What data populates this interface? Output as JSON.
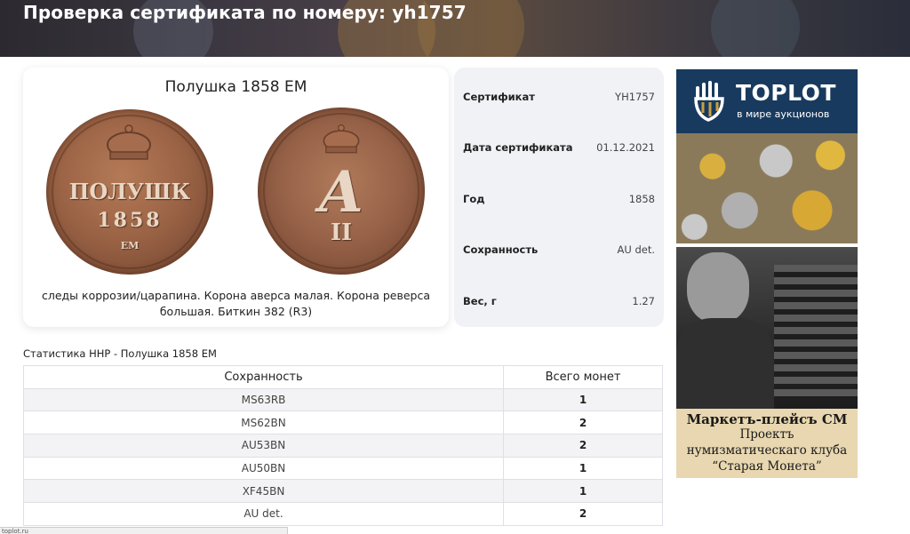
{
  "header": {
    "title": "Проверка сертификата по номеру: yh1757"
  },
  "coin_card": {
    "title": "Полушка 1858 ЕМ",
    "obverse_text": {
      "line1": "ПОЛУШК",
      "line2": "1858",
      "line3": "ЕМ"
    },
    "reverse_text": {
      "line1": "А",
      "line2": "II"
    },
    "description": "следы коррозии/царапина. Корона аверса малая. Корона реверса большая. Биткин 382 (R3)"
  },
  "info": {
    "rows": [
      {
        "label": "Сертификат",
        "value": "YH1757"
      },
      {
        "label": "Дата сертификата",
        "value": "01.12.2021"
      },
      {
        "label": "Год",
        "value": "1858"
      },
      {
        "label": "Сохранность",
        "value": "AU det."
      },
      {
        "label": "Вес, г",
        "value": "1.27"
      }
    ]
  },
  "stats": {
    "title": "Статистика ННР - Полушка 1858 ЕМ",
    "headers": [
      "Сохранность",
      "Всего монет"
    ],
    "rows": [
      [
        "MS63RB",
        "1"
      ],
      [
        "MS62BN",
        "2"
      ],
      [
        "AU53BN",
        "2"
      ],
      [
        "AU50BN",
        "1"
      ],
      [
        "XF45BN",
        "1"
      ],
      [
        "AU det.",
        "2"
      ]
    ]
  },
  "ads": {
    "toplot": {
      "brand": "TOPLOT",
      "tagline": "в мире аукционов"
    },
    "market": {
      "line1": "Маркетъ-плейсъ СМ",
      "line2": "Проектъ",
      "line3": "нумизматическаго клуба",
      "line4": "“Старая Монета”"
    }
  },
  "statusbar": {
    "text": "toplot.ru"
  },
  "colors": {
    "toplot_bg": "#183a5e",
    "info_bg": "#f1f2f6",
    "table_stripe": "#f3f3f5"
  }
}
